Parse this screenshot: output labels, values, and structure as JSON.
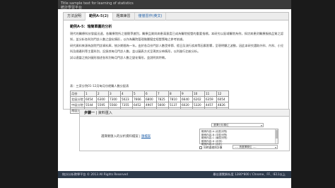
{
  "header": {
    "title": "Title sample text for learning of statistics",
    "subtitle": "統計學習平台"
  },
  "tabs": [
    {
      "label": "方法說明",
      "active": false
    },
    {
      "label": "範例A-5(2)",
      "active": true
    },
    {
      "label": "題庫練習",
      "active": false
    },
    {
      "label": "僅僅習作(英文)",
      "active": false
    }
  ],
  "section": {
    "title": "範例A-5：瑞簡單圖的分析",
    "paragraphs": [
      "現代的醫療科技發展迅速，各醫療院所之間競爭激烈，醫療品質與病患滿意度已成為醫院經營的重要指標。本研究以區域醫院為例，探討病患對醫療服務品質之認知，並分析各科別門診人數之變化情形，以作為醫院管理階層擬定經營策略之參考依據。",
      "研究資料來源為該院門診資料庫，統計期間為一年。由於各月份門診人數受季節、假日及流行疾病等因素影響，呈現明顯之波動，因此本研究選取外科、內科、小兒科及婦產科等主要科別，記錄其每月門診人數，並以圖表方式呈現其分佈情形，以利進行比較分析。",
      "試以適當之統計圖形描述各科別每月門診人數之變化情形，並說明其特徵。"
    ]
  },
  "table": {
    "caption": "表：三家分院01-12月每月份就醫人數分配表",
    "columns": [
      "月份",
      "1",
      "2",
      "3",
      "4",
      "5",
      "6",
      "7",
      "8",
      "9",
      "10",
      "11",
      "12"
    ],
    "rows": [
      {
        "name": "北區分院",
        "values": [
          "6054",
          "6300",
          "7300",
          "5023",
          "7666",
          "6800",
          "7825",
          "7810",
          "6640",
          "6202",
          "6359",
          "6054"
        ]
      },
      {
        "name": "中區分院",
        "values": [
          "5544",
          "5595",
          "5560",
          "7355",
          "6452",
          "4907",
          "5600",
          "5137",
          "6020",
          "5320",
          "4457",
          "4826"
        ]
      },
      {
        "name": "南區分院",
        "values": [
          "5017",
          "5505",
          "5454",
          "3598",
          "4150",
          "4406",
          "4922",
          "4882",
          "4275",
          "5040",
          "4450",
          "4520"
        ]
      }
    ]
  },
  "step": {
    "label": "步驟一",
    "title": "資料匯入",
    "prompt": "選擇要匯入的分析資料檔案",
    "prompt_link": "匯檔案",
    "prompt_prefix": "請選擇欲分析的資料欄位：",
    "top_select": "選擇分析欄位",
    "list_options": [
      "範例內容-A (北區分院)",
      "範例內容-B (中區分院)",
      "範例內容-C (南區分院)",
      "範例內容-D (月份)",
      "範例內容-E (合計)"
    ],
    "check_label": "同時處理與計算",
    "mini_select": "---- 請選擇欄位 ----"
  },
  "footer": {
    "left": "統計分析教學平台 © 2013 All Rights Reserved",
    "right": "最佳瀏覽解析度 1280*800 / Chrome、FF、IE11以上"
  }
}
